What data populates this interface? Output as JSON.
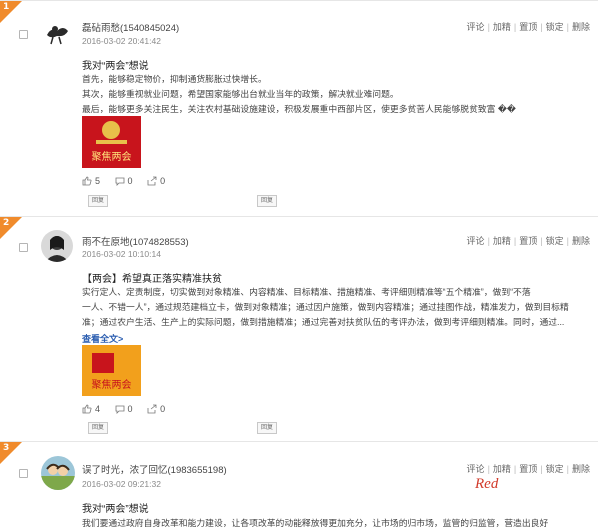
{
  "posts": [
    {
      "rank": "1",
      "username": "磊砧雨愁(1540845024)",
      "date": "2016-03-02 20:41:42",
      "actions": [
        "评论",
        "加精",
        "置顶",
        "锁定",
        "删除"
      ],
      "title": "我对“两会”想说",
      "body_lines": [
        "首先，能够稳定物价，抑制通货膨胀过快增长。",
        "其次，能够重视就业问题，希望国家能够出台就业当年的政策，解决就业难问题。",
        "最后，能够更多关注民生，关注农村基础设施建设，积极发展重中西部片区，使更多贫苦人民能够脱贫致富 ��"
      ],
      "thumb_text": "聚焦两会",
      "likes": "5",
      "comments": "0",
      "shares": "0",
      "btn_label": "回复"
    },
    {
      "rank": "2",
      "username": "雨不在原地(1074828553)",
      "date": "2016-03-02 10:10:14",
      "actions": [
        "评论",
        "加精",
        "置顶",
        "锁定",
        "删除"
      ],
      "title": "【两会】希望真正落实精准扶贫",
      "body_lines": [
        "实行定人、定责制度，切实做到对象精准、内容精准、目标精准、措施精准、考评细则精准等“五个精准”，做到“不落",
        "一人、不错一人”，通过规范建档立卡，做到对象精准；通过因户施策，做到内容精准；通过挂图作战，精准发力，做到目标精",
        "准；通过农户生活、生产上的实际问题，做到措施精准；通过完善对扶贫队伍的考评办法，做到考评细则精准。同时，通过..."
      ],
      "expand_label": "查看全文>",
      "thumb_text": "聚焦两会",
      "likes": "4",
      "comments": "0",
      "shares": "0",
      "btn_label": "回复"
    },
    {
      "rank": "3",
      "username": "误了时光，浓了回忆(1983655198)",
      "date": "2016-03-02 09:21:32",
      "actions": [
        "评论",
        "加精",
        "置顶",
        "锁定",
        "删除"
      ],
      "title": "我对“两会”想说",
      "body_lines": [
        "我们要通过政府自身改革和能力建设，让各项改革的动能释放得更加充分，让市场的归市场，监管的归监管，营造出良好"
      ]
    }
  ],
  "red_note": "Red",
  "colors": {
    "rank_flag": "#f08b2c",
    "link": "#2a5db0",
    "annotation": "#d23a2a"
  }
}
